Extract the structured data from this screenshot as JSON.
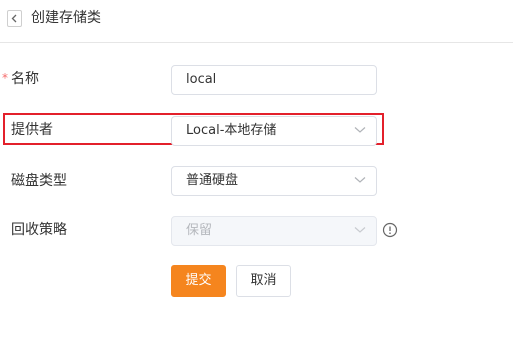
{
  "header": {
    "title": "创建存储类"
  },
  "form": {
    "name": {
      "label": "名称",
      "required_mark": "*",
      "value": "local"
    },
    "provider": {
      "label": "提供者",
      "value": "Local-本地存储"
    },
    "disk_type": {
      "label": "磁盘类型",
      "value": "普通硬盘"
    },
    "reclaim_policy": {
      "label": "回收策略",
      "value": "保留",
      "disabled": true
    }
  },
  "actions": {
    "submit_label": "提交",
    "cancel_label": "取消"
  },
  "colors": {
    "accent": "#f5851e",
    "highlight": "#e3202b",
    "required": "#f56c6c"
  },
  "icons": {
    "back": "chevron-left-icon",
    "dropdown": "chevron-down-icon",
    "info": "info-icon"
  }
}
